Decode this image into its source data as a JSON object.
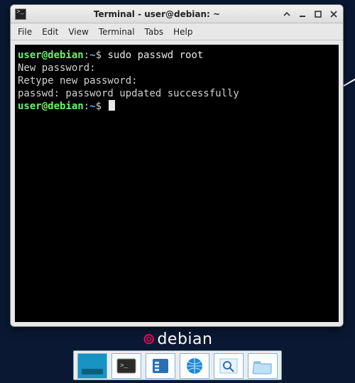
{
  "window": {
    "title": "Terminal - user@debian: ~"
  },
  "menu": {
    "items": [
      "File",
      "Edit",
      "View",
      "Terminal",
      "Tabs",
      "Help"
    ]
  },
  "prompt": {
    "user": "user",
    "at": "@",
    "host": "debian",
    "colon": ":",
    "path": "~",
    "sigil": "$ "
  },
  "terminal": {
    "cmd1": "sudo passwd root",
    "out1": "New password:",
    "out2": "Retype new password:",
    "out3": "passwd: password updated successfully"
  },
  "desktop": {
    "distro": "debian"
  },
  "taskbar": {
    "items": [
      {
        "name": "show-desktop"
      },
      {
        "name": "terminal"
      },
      {
        "name": "file-manager"
      },
      {
        "name": "web-browser"
      },
      {
        "name": "search"
      },
      {
        "name": "folder"
      }
    ]
  }
}
